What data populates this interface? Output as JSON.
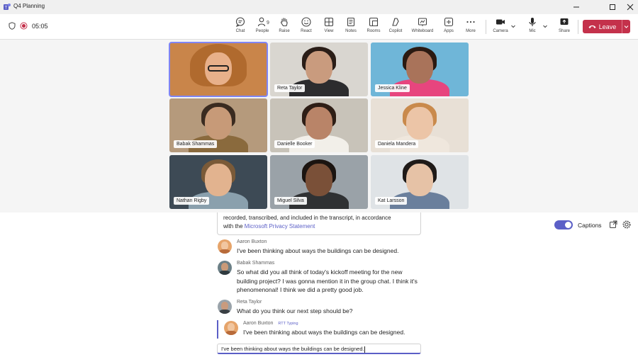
{
  "window": {
    "title": "Q4 Planning",
    "brand_color": "#5b5fc7"
  },
  "toolbar": {
    "timer": "05:05",
    "people_count": "9",
    "buttons": [
      {
        "label": "Chat",
        "icon": "chat-icon"
      },
      {
        "label": "People",
        "icon": "people-icon"
      },
      {
        "label": "Raise",
        "icon": "raise-hand-icon"
      },
      {
        "label": "React",
        "icon": "react-icon"
      },
      {
        "label": "View",
        "icon": "view-icon"
      },
      {
        "label": "Notes",
        "icon": "notes-icon"
      },
      {
        "label": "Rooms",
        "icon": "rooms-icon"
      },
      {
        "label": "Copilot",
        "icon": "copilot-icon"
      },
      {
        "label": "Whiteboard",
        "icon": "whiteboard-icon"
      },
      {
        "label": "Apps",
        "icon": "apps-icon"
      },
      {
        "label": "More",
        "icon": "more-icon"
      },
      {
        "label": "Camera",
        "icon": "camera-icon"
      },
      {
        "label": "Mic",
        "icon": "mic-icon"
      },
      {
        "label": "Share",
        "icon": "share-icon"
      }
    ],
    "leave_label": "Leave",
    "leave_color": "#c4314b"
  },
  "participants": [
    {
      "name": ""
    },
    {
      "name": "Reta Taylor"
    },
    {
      "name": "Jessica Kline"
    },
    {
      "name": "Babak Shammas"
    },
    {
      "name": "Danielle Booker"
    },
    {
      "name": "Daniela Mandera"
    },
    {
      "name": "Nathan Rigby"
    },
    {
      "name": "Miguel Silva"
    },
    {
      "name": "Kat Larsson"
    }
  ],
  "captions": {
    "toggle_label": "Captions",
    "toggle_on": true,
    "privacy_line1": "recorded, transcribed, and included in the transcript, in accordance",
    "privacy_line2_prefix": "with the ",
    "privacy_link": "Microsoft Privacy Statement",
    "messages": [
      {
        "author": "Aaron Buxton",
        "text": "I've been thinking about ways the buildings can be designed."
      },
      {
        "author": "Babak Shammas",
        "text": "So what did you all think of today's kickoff meeting for the new building project? I was gonna mention it in the group chat. I think it's phenomenonal! I think we did a pretty good job."
      },
      {
        "author": "Reta Taylor",
        "text": "What do you think our next step should be?"
      },
      {
        "author": "Aaron Buxton",
        "tag": "RTT Typing",
        "text": "I've been thinking about ways the buildings can be designed."
      }
    ],
    "composer_value": "I've been thinking about ways the buildings can be designed."
  }
}
